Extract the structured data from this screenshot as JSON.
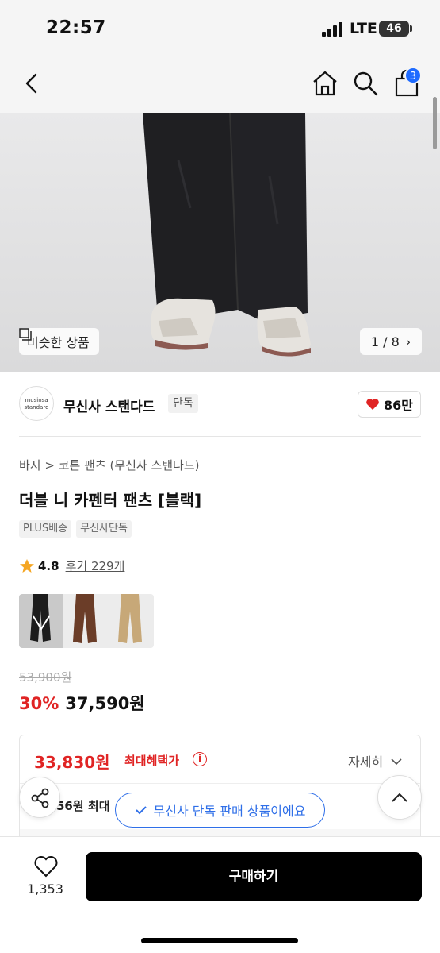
{
  "status_bar": {
    "time": "22:57",
    "network": "LTE",
    "battery": "46"
  },
  "nav": {
    "cart_count": "3"
  },
  "hero": {
    "similar_label": "비슷한 상품",
    "page_counter": "1 / 8"
  },
  "brand": {
    "logo_text_1": "musinsa",
    "logo_text_2": "standard",
    "name": "무신사 스탠다드",
    "tag": "단독",
    "likes": "86만"
  },
  "product": {
    "breadcrumb": "바지 > 코튼 팬츠 (무신사 스탠다드)",
    "title": "더블 니 카펜터 팬츠 [블랙]",
    "tags": [
      "PLUS배송",
      "무신사단독"
    ],
    "rating": "4.8",
    "reviews": "후기 229개",
    "color_options": [
      "black",
      "brown",
      "beige"
    ]
  },
  "price": {
    "original": "53,900원",
    "discount": "30%",
    "sale": "37,590원"
  },
  "benefit": {
    "max_price": "33,830원",
    "max_label": "최대혜택가",
    "detail": "자세히",
    "sub_text": "56원 최대"
  },
  "toast": {
    "text": "무신사 단독 판매 상품이에요"
  },
  "bottom": {
    "wish_count": "1,353",
    "buy_label": "구매하기"
  },
  "colors": {
    "accent_red": "#e02424",
    "accent_blue": "#2f6fe8",
    "badge_blue": "#1f6bff"
  }
}
